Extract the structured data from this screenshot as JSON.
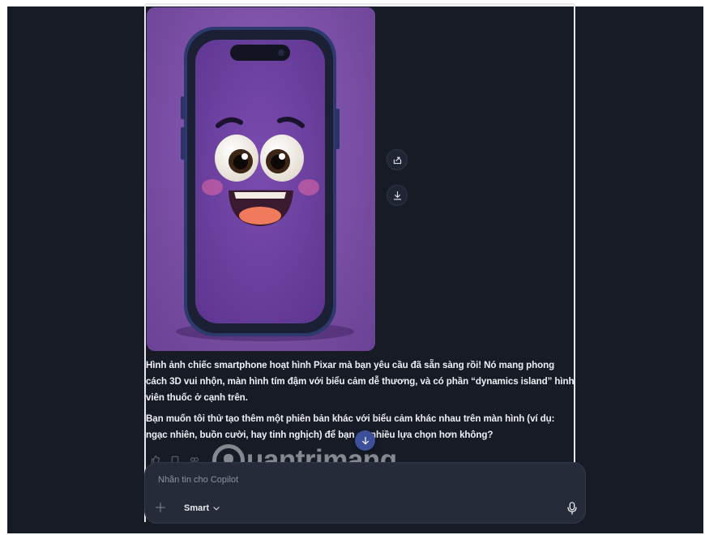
{
  "message": {
    "paragraph1": "Hình ảnh chiếc smartphone hoạt hình Pixar mà bạn yêu cầu đã sẵn sàng rồi! Nó mang phong cách 3D vui nhộn, màn hình tím đậm với biểu cảm dễ thương, và có phần “dynamics island” hình viên thuốc ở cạnh trên.",
    "paragraph2": "Bạn muốn tôi thử tạo thêm một phiên bản khác với biểu cảm khác nhau trên màn hình (ví dụ: ngạc nhiên, buồn cười, hay tinh nghịch) để bạn có nhiều lựa chọn hơn không?"
  },
  "image_actions": {
    "share_icon": "share-icon",
    "download_icon": "download-icon"
  },
  "composer": {
    "placeholder": "Nhắn tin cho Copilot",
    "mode_label": "Smart"
  },
  "watermark": {
    "text": "uantrimang"
  },
  "colors": {
    "background": "#161b26",
    "image_purple": "#7a4fa5",
    "composer_bg": "#252b38",
    "scroll_button": "#3b4f9a"
  }
}
